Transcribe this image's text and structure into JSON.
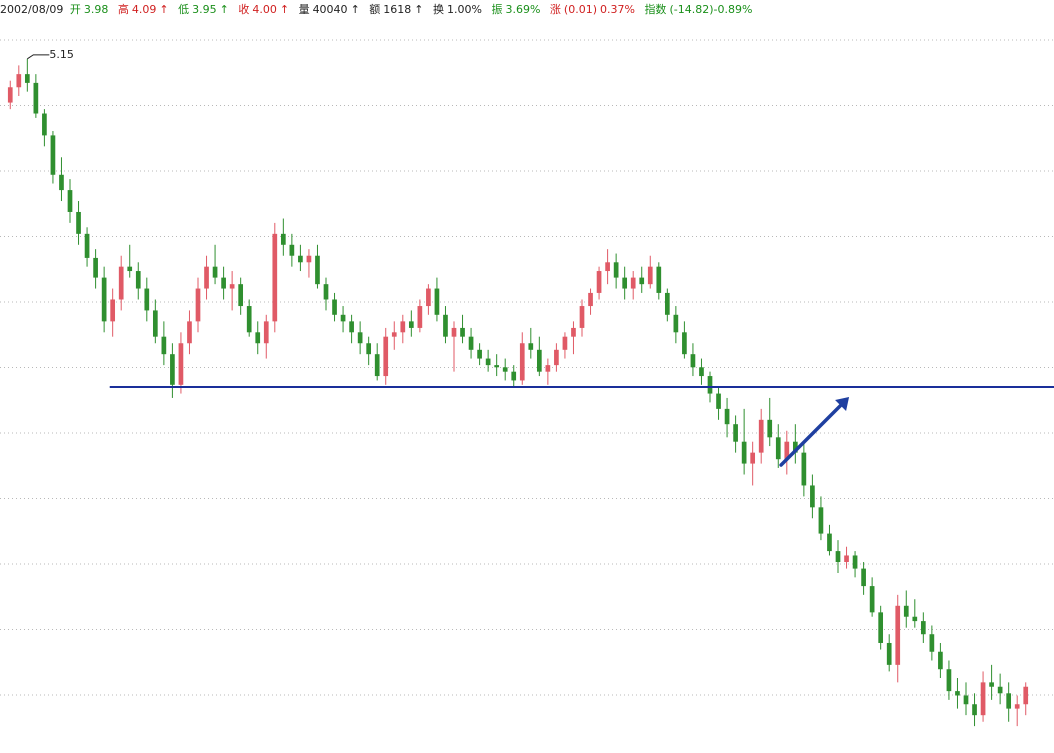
{
  "header": {
    "date": "2002/08/09",
    "open": {
      "label": "开",
      "value": "3.98",
      "color": "#1a8f1a"
    },
    "high": {
      "label": "高",
      "value": "4.09",
      "arrow": "↑",
      "color": "#d02020"
    },
    "low": {
      "label": "低",
      "value": "3.95",
      "arrow": "↑",
      "color": "#1a8f1a"
    },
    "close": {
      "label": "收",
      "value": "4.00",
      "arrow": "↑",
      "color": "#d02020"
    },
    "volume": {
      "label": "量",
      "value": "40040",
      "arrow": "↑",
      "color": "#222222"
    },
    "deals": {
      "label": "额",
      "value": "1618",
      "arrow": "↑",
      "color": "#222222"
    },
    "turnover": {
      "label": "换",
      "value": "1.00%",
      "color": "#222222"
    },
    "amplitude": {
      "label": "振",
      "value": "3.69%",
      "color": "#1a8f1a"
    },
    "change": {
      "label": "涨",
      "value": "(0.01)",
      "pct": "0.37%",
      "color": "#d02020"
    },
    "index": {
      "label": "指数",
      "value": "(-14.82)-0.89%",
      "color": "#1a8f1a"
    }
  },
  "chart_data": {
    "type": "candlestick",
    "title": "",
    "xlabel": "",
    "ylabel": "",
    "ylim": [
      2.0,
      5.3
    ],
    "grid": "horizontal-dotted",
    "peak_label": {
      "text": "5.15",
      "value": 5.15
    },
    "colors": {
      "up": "#e05a66",
      "down": "#2f8f2f",
      "support_line": "#1a2f9a",
      "arrow": "#1f3fa0"
    },
    "support_level": 3.65,
    "support_span": {
      "from_index": 14,
      "to_index": 123
    },
    "arrow_annotation": {
      "points_to_index": 99,
      "direction": "up-right"
    },
    "candles": [
      [
        4.95,
        5.05,
        4.92,
        5.02
      ],
      [
        5.02,
        5.12,
        4.98,
        5.08
      ],
      [
        5.08,
        5.15,
        5.0,
        5.04
      ],
      [
        5.04,
        5.08,
        4.88,
        4.9
      ],
      [
        4.9,
        4.92,
        4.75,
        4.8
      ],
      [
        4.8,
        4.82,
        4.58,
        4.62
      ],
      [
        4.62,
        4.7,
        4.5,
        4.55
      ],
      [
        4.55,
        4.6,
        4.4,
        4.45
      ],
      [
        4.45,
        4.5,
        4.3,
        4.35
      ],
      [
        4.35,
        4.38,
        4.2,
        4.24
      ],
      [
        4.24,
        4.28,
        4.1,
        4.15
      ],
      [
        4.15,
        4.2,
        3.9,
        3.95
      ],
      [
        3.95,
        4.1,
        3.88,
        4.05
      ],
      [
        4.05,
        4.25,
        4.0,
        4.2
      ],
      [
        4.2,
        4.3,
        4.15,
        4.18
      ],
      [
        4.18,
        4.22,
        4.05,
        4.1
      ],
      [
        4.1,
        4.15,
        3.95,
        4.0
      ],
      [
        4.0,
        4.05,
        3.85,
        3.88
      ],
      [
        3.88,
        3.95,
        3.75,
        3.8
      ],
      [
        3.8,
        3.85,
        3.6,
        3.66
      ],
      [
        3.66,
        3.9,
        3.62,
        3.85
      ],
      [
        3.85,
        4.0,
        3.8,
        3.95
      ],
      [
        3.95,
        4.15,
        3.9,
        4.1
      ],
      [
        4.1,
        4.25,
        4.05,
        4.2
      ],
      [
        4.2,
        4.3,
        4.12,
        4.15
      ],
      [
        4.15,
        4.2,
        4.05,
        4.1
      ],
      [
        4.1,
        4.18,
        4.0,
        4.12
      ],
      [
        4.12,
        4.15,
        3.98,
        4.02
      ],
      [
        4.02,
        4.05,
        3.88,
        3.9
      ],
      [
        3.9,
        3.95,
        3.8,
        3.85
      ],
      [
        3.85,
        3.98,
        3.78,
        3.95
      ],
      [
        3.95,
        4.4,
        3.9,
        4.35
      ],
      [
        4.35,
        4.42,
        4.25,
        4.3
      ],
      [
        4.3,
        4.35,
        4.2,
        4.25
      ],
      [
        4.25,
        4.3,
        4.18,
        4.22
      ],
      [
        4.22,
        4.28,
        4.15,
        4.25
      ],
      [
        4.25,
        4.3,
        4.1,
        4.12
      ],
      [
        4.12,
        4.15,
        4.0,
        4.05
      ],
      [
        4.05,
        4.08,
        3.95,
        3.98
      ],
      [
        3.98,
        4.02,
        3.9,
        3.95
      ],
      [
        3.95,
        3.98,
        3.85,
        3.9
      ],
      [
        3.9,
        3.95,
        3.8,
        3.85
      ],
      [
        3.85,
        3.88,
        3.75,
        3.8
      ],
      [
        3.8,
        3.85,
        3.68,
        3.7
      ],
      [
        3.7,
        3.92,
        3.66,
        3.88
      ],
      [
        3.88,
        3.95,
        3.82,
        3.9
      ],
      [
        3.9,
        3.98,
        3.85,
        3.95
      ],
      [
        3.95,
        4.0,
        3.88,
        3.92
      ],
      [
        3.92,
        4.05,
        3.9,
        4.02
      ],
      [
        4.02,
        4.12,
        3.98,
        4.1
      ],
      [
        4.1,
        4.15,
        3.95,
        3.98
      ],
      [
        3.98,
        4.02,
        3.85,
        3.88
      ],
      [
        3.88,
        3.95,
        3.72,
        3.92
      ],
      [
        3.92,
        3.98,
        3.85,
        3.88
      ],
      [
        3.88,
        3.92,
        3.78,
        3.82
      ],
      [
        3.82,
        3.85,
        3.75,
        3.78
      ],
      [
        3.78,
        3.82,
        3.72,
        3.75
      ],
      [
        3.75,
        3.8,
        3.7,
        3.74
      ],
      [
        3.74,
        3.78,
        3.68,
        3.72
      ],
      [
        3.72,
        3.75,
        3.65,
        3.68
      ],
      [
        3.68,
        3.9,
        3.66,
        3.85
      ],
      [
        3.85,
        3.92,
        3.78,
        3.82
      ],
      [
        3.82,
        3.88,
        3.7,
        3.72
      ],
      [
        3.72,
        3.78,
        3.66,
        3.75
      ],
      [
        3.75,
        3.85,
        3.72,
        3.82
      ],
      [
        3.82,
        3.9,
        3.78,
        3.88
      ],
      [
        3.88,
        3.95,
        3.8,
        3.92
      ],
      [
        3.92,
        4.05,
        3.88,
        4.02
      ],
      [
        4.02,
        4.1,
        3.98,
        4.08
      ],
      [
        4.08,
        4.2,
        4.05,
        4.18
      ],
      [
        4.18,
        4.28,
        4.12,
        4.22
      ],
      [
        4.22,
        4.26,
        4.1,
        4.15
      ],
      [
        4.15,
        4.2,
        4.05,
        4.1
      ],
      [
        4.1,
        4.18,
        4.05,
        4.15
      ],
      [
        4.15,
        4.2,
        4.08,
        4.12
      ],
      [
        4.12,
        4.25,
        4.1,
        4.2
      ],
      [
        4.2,
        4.22,
        4.05,
        4.08
      ],
      [
        4.08,
        4.1,
        3.95,
        3.98
      ],
      [
        3.98,
        4.02,
        3.85,
        3.9
      ],
      [
        3.9,
        3.95,
        3.78,
        3.8
      ],
      [
        3.8,
        3.85,
        3.7,
        3.74
      ],
      [
        3.74,
        3.78,
        3.66,
        3.7
      ],
      [
        3.7,
        3.72,
        3.58,
        3.62
      ],
      [
        3.62,
        3.65,
        3.5,
        3.55
      ],
      [
        3.55,
        3.6,
        3.42,
        3.48
      ],
      [
        3.48,
        3.52,
        3.35,
        3.4
      ],
      [
        3.4,
        3.55,
        3.25,
        3.3
      ],
      [
        3.3,
        3.4,
        3.2,
        3.35
      ],
      [
        3.35,
        3.55,
        3.3,
        3.5
      ],
      [
        3.5,
        3.6,
        3.38,
        3.42
      ],
      [
        3.42,
        3.48,
        3.28,
        3.32
      ],
      [
        3.32,
        3.45,
        3.25,
        3.4
      ],
      [
        3.4,
        3.48,
        3.3,
        3.35
      ],
      [
        3.35,
        3.4,
        3.15,
        3.2
      ],
      [
        3.2,
        3.25,
        3.05,
        3.1
      ],
      [
        3.1,
        3.15,
        2.95,
        2.98
      ],
      [
        2.98,
        3.02,
        2.88,
        2.9
      ],
      [
        2.9,
        2.95,
        2.8,
        2.85
      ],
      [
        2.85,
        2.92,
        2.82,
        2.88
      ],
      [
        2.88,
        2.9,
        2.78,
        2.82
      ],
      [
        2.82,
        2.85,
        2.7,
        2.74
      ],
      [
        2.74,
        2.78,
        2.6,
        2.62
      ],
      [
        2.62,
        2.65,
        2.45,
        2.48
      ],
      [
        2.48,
        2.52,
        2.35,
        2.38
      ],
      [
        2.38,
        2.7,
        2.3,
        2.65
      ],
      [
        2.65,
        2.72,
        2.55,
        2.6
      ],
      [
        2.6,
        2.68,
        2.55,
        2.58
      ],
      [
        2.58,
        2.62,
        2.48,
        2.52
      ],
      [
        2.52,
        2.56,
        2.4,
        2.44
      ],
      [
        2.44,
        2.48,
        2.32,
        2.36
      ],
      [
        2.36,
        2.4,
        2.22,
        2.26
      ],
      [
        2.26,
        2.32,
        2.18,
        2.24
      ],
      [
        2.24,
        2.3,
        2.15,
        2.2
      ],
      [
        2.2,
        2.25,
        2.1,
        2.15
      ],
      [
        2.15,
        2.35,
        2.12,
        2.3
      ],
      [
        2.3,
        2.38,
        2.22,
        2.28
      ],
      [
        2.28,
        2.34,
        2.2,
        2.25
      ],
      [
        2.25,
        2.3,
        2.12,
        2.18
      ],
      [
        2.18,
        2.24,
        2.1,
        2.2
      ],
      [
        2.2,
        2.3,
        2.15,
        2.28
      ]
    ]
  }
}
